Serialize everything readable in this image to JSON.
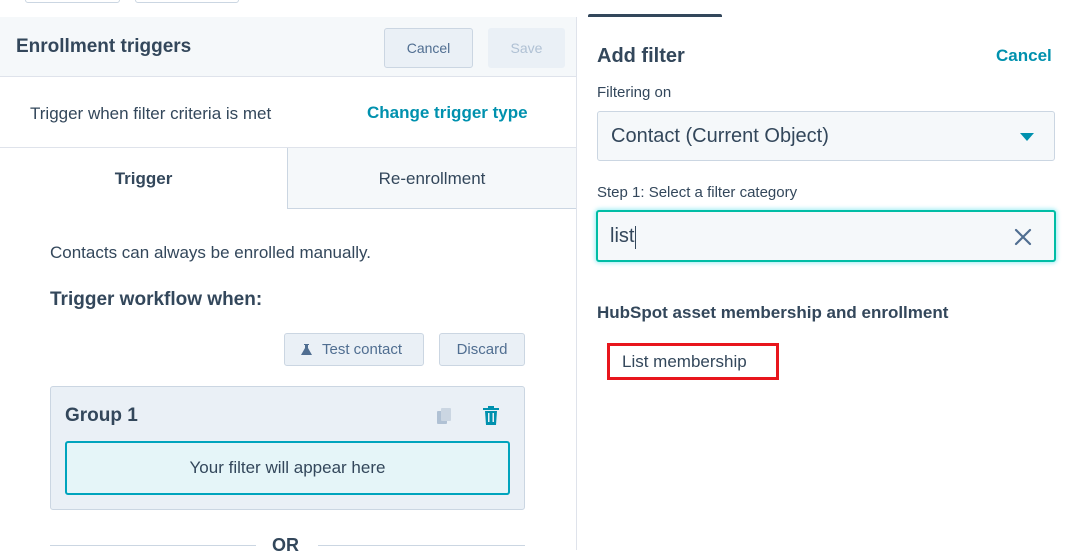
{
  "colors": {
    "accent": "#0091ae",
    "focus": "#00bda5",
    "highlight_box": "#e8161c",
    "text": "#33475b",
    "panel_bg": "#f5f8fa"
  },
  "left_panel": {
    "title": "Enrollment triggers",
    "cancel_label": "Cancel",
    "save_label": "Save",
    "trigger_text": "Trigger when filter criteria is met",
    "change_trigger_label": "Change trigger type",
    "tabs": [
      {
        "label": "Trigger",
        "active": true
      },
      {
        "label": "Re-enrollment",
        "active": false
      }
    ],
    "manual_note": "Contacts can always be enrolled manually.",
    "trigger_heading": "Trigger workflow when:",
    "test_contact_label": "Test contact",
    "test_contact_icon": "flask-icon",
    "discard_label": "Discard",
    "group": {
      "title": "Group 1",
      "copy_icon": "copy-icon",
      "delete_icon": "trash-icon",
      "placeholder": "Your filter will appear here"
    },
    "or_label": "OR"
  },
  "right_panel": {
    "title": "Add filter",
    "cancel_label": "Cancel",
    "filtering_on_label": "Filtering on",
    "filtering_on_value": "Contact (Current Object)",
    "step_label": "Step 1: Select a filter category",
    "search_value": "list",
    "clear_icon": "close-icon",
    "section_title": "HubSpot asset membership and enrollment",
    "results": [
      {
        "label": "List membership",
        "highlighted": true
      }
    ]
  }
}
